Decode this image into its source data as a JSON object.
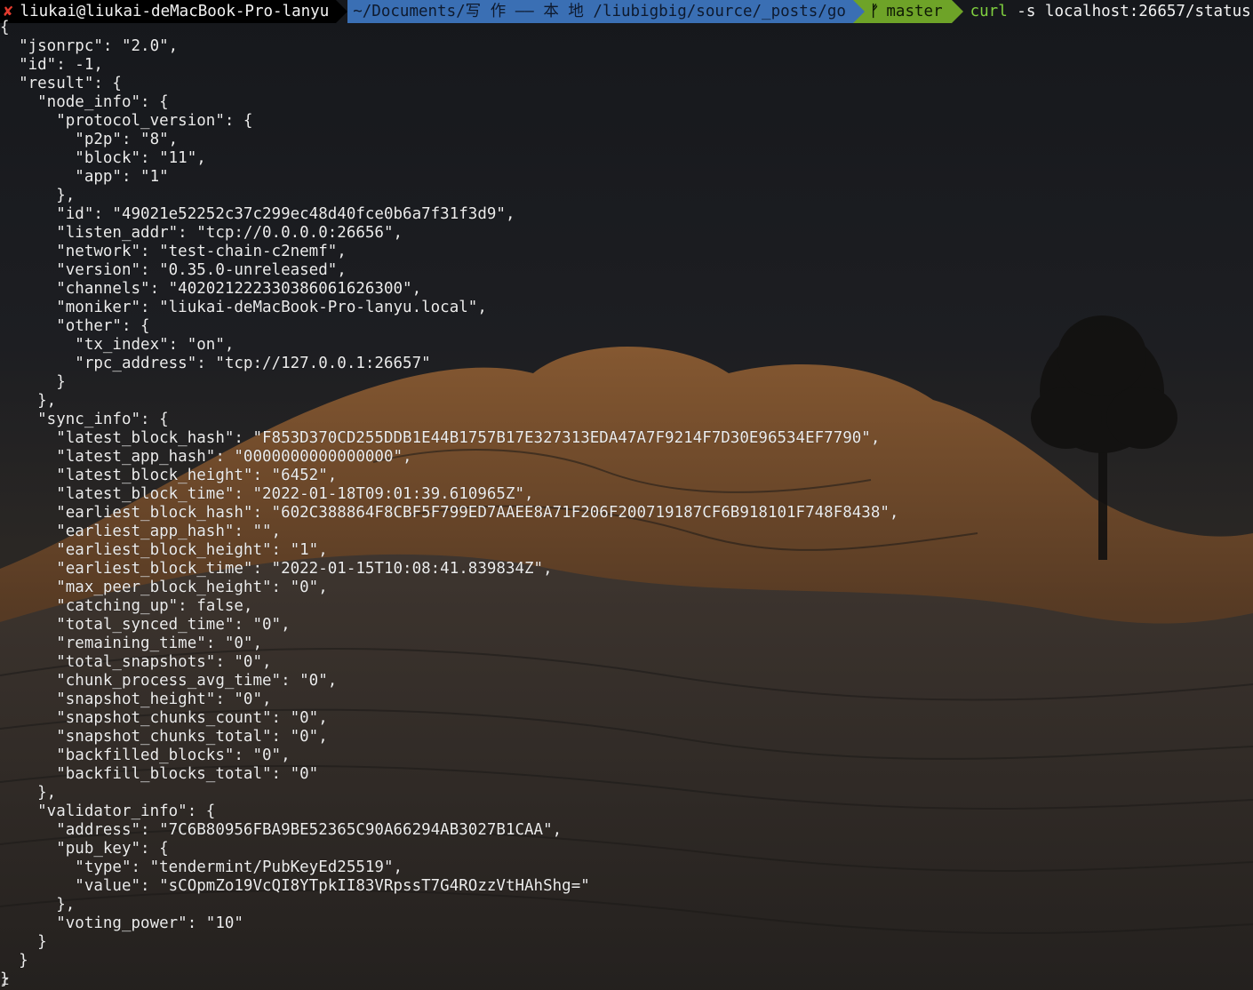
{
  "colors": {
    "sky_top": "#1a1c20",
    "rock_mid": "#5a3a22",
    "rock_dark": "#2a2624",
    "prompt_user_bg": "#000000",
    "prompt_path_bg": "#3a6fb4",
    "prompt_git_bg": "#6ea328",
    "error_mark": "#e23b2e",
    "command_name": "#7fcf3f"
  },
  "prompt": {
    "status_mark": "✘",
    "user_host": "liukai@liukai-deMacBook-Pro-lanyu",
    "path": "~/Documents/写 作 —— 本 地 /liubigbig/source/_posts/go",
    "git_icon": "branch-icon",
    "git_glyph": "ᚠ",
    "branch": "master",
    "command": "curl",
    "args": " -s localhost:26657/status"
  },
  "output_lines": [
    "{",
    "  \"jsonrpc\": \"2.0\",",
    "  \"id\": -1,",
    "  \"result\": {",
    "    \"node_info\": {",
    "      \"protocol_version\": {",
    "        \"p2p\": \"8\",",
    "        \"block\": \"11\",",
    "        \"app\": \"1\"",
    "      },",
    "      \"id\": \"49021e52252c37c299ec48d40fce0b6a7f31f3d9\",",
    "      \"listen_addr\": \"tcp://0.0.0.0:26656\",",
    "      \"network\": \"test-chain-c2nemf\",",
    "      \"version\": \"0.35.0-unreleased\",",
    "      \"channels\": \"402021222330386061626300\",",
    "      \"moniker\": \"liukai-deMacBook-Pro-lanyu.local\",",
    "      \"other\": {",
    "        \"tx_index\": \"on\",",
    "        \"rpc_address\": \"tcp://127.0.0.1:26657\"",
    "      }",
    "    },",
    "    \"sync_info\": {",
    "      \"latest_block_hash\": \"F853D370CD255DDB1E44B1757B17E327313EDA47A7F9214F7D30E96534EF7790\",",
    "      \"latest_app_hash\": \"0000000000000000\",",
    "      \"latest_block_height\": \"6452\",",
    "      \"latest_block_time\": \"2022-01-18T09:01:39.610965Z\",",
    "      \"earliest_block_hash\": \"602C388864F8CBF5F799ED7AAEE8A71F206F200719187CF6B918101F748F8438\",",
    "      \"earliest_app_hash\": \"\",",
    "      \"earliest_block_height\": \"1\",",
    "      \"earliest_block_time\": \"2022-01-15T10:08:41.839834Z\",",
    "      \"max_peer_block_height\": \"0\",",
    "      \"catching_up\": false,",
    "      \"total_synced_time\": \"0\",",
    "      \"remaining_time\": \"0\",",
    "      \"total_snapshots\": \"0\",",
    "      \"chunk_process_avg_time\": \"0\",",
    "      \"snapshot_height\": \"0\",",
    "      \"snapshot_chunks_count\": \"0\",",
    "      \"snapshot_chunks_total\": \"0\",",
    "      \"backfilled_blocks\": \"0\",",
    "      \"backfill_blocks_total\": \"0\"",
    "    },",
    "    \"validator_info\": {",
    "      \"address\": \"7C6B80956FBA9BE52365C90A66294AB3027B1CAA\",",
    "      \"pub_key\": {",
    "        \"type\": \"tendermint/PubKeyEd25519\",",
    "        \"value\": \"sCOpmZo19VcQI8YTpkII83VRpssT7G4ROzzVtHAhShg=\"",
    "      },",
    "      \"voting_power\": \"10\"",
    "    }",
    "  }",
    "}"
  ],
  "cursor_glyph": "⌶"
}
